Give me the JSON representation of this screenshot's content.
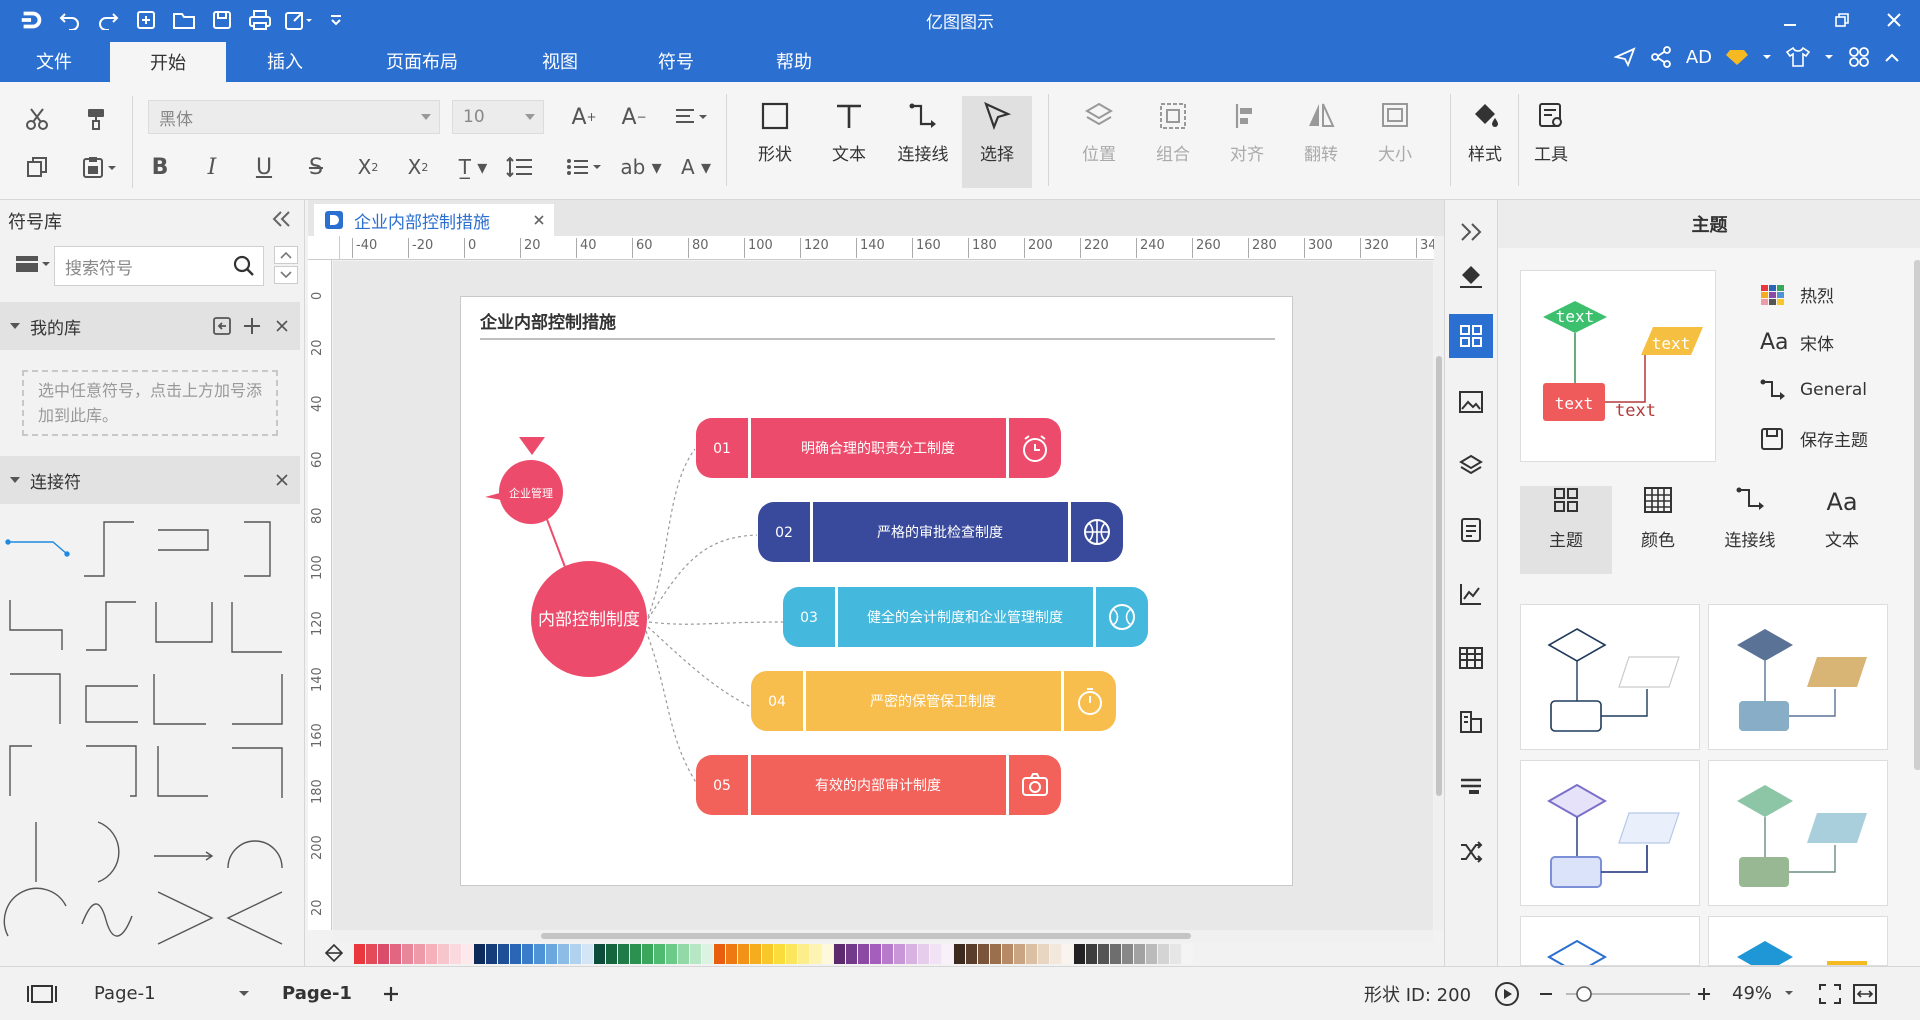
{
  "app": {
    "title": "亿图图示"
  },
  "menus": [
    {
      "label": "文件"
    },
    {
      "label": "开始"
    },
    {
      "label": "插入"
    },
    {
      "label": "页面布局"
    },
    {
      "label": "视图"
    },
    {
      "label": "符号"
    },
    {
      "label": "帮助"
    }
  ],
  "account": {
    "label": "AD"
  },
  "ribbon": {
    "font_name": "黑体",
    "font_size": "10",
    "big_buttons": [
      {
        "label": "形状"
      },
      {
        "label": "文本"
      },
      {
        "label": "连接线"
      },
      {
        "label": "选择"
      },
      {
        "label": "位置"
      },
      {
        "label": "组合"
      },
      {
        "label": "对齐"
      },
      {
        "label": "翻转"
      },
      {
        "label": "大小"
      },
      {
        "label": "样式"
      },
      {
        "label": "工具"
      }
    ]
  },
  "left_panel": {
    "title": "符号库",
    "search_placeholder": "搜索符号",
    "my_library": "我的库",
    "hint": "选中任意符号，点击上方加号添加到此库。",
    "connectors": "连接符"
  },
  "document": {
    "tab_title": "企业内部控制措施"
  },
  "ruler": {
    "h": [
      "-40",
      "-20",
      "0",
      "20",
      "40",
      "60",
      "80",
      "100",
      "120",
      "140",
      "160",
      "180",
      "200",
      "220",
      "240",
      "260",
      "280",
      "300",
      "320",
      "34"
    ],
    "v": [
      "0",
      "20",
      "40",
      "60",
      "80",
      "100",
      "120",
      "140",
      "160",
      "180",
      "200",
      "20"
    ]
  },
  "diagram": {
    "title": "企业内部控制措施",
    "center": "内部控制制度",
    "small": "企业管理",
    "items": [
      {
        "num": "01",
        "text": "明确合理的职责分工制度",
        "color": "#ec4b6b",
        "icon": "alarm-clock-icon"
      },
      {
        "num": "02",
        "text": "严格的审批检查制度",
        "color": "#394a9c",
        "icon": "basketball-icon"
      },
      {
        "num": "03",
        "text": "健全的会计制度和企业管理制度",
        "color": "#44b8dd",
        "icon": "baseball-icon"
      },
      {
        "num": "04",
        "text": "严密的保管保卫制度",
        "color": "#f7bd4d",
        "icon": "stopwatch-icon"
      },
      {
        "num": "05",
        "text": "有效的内部审计制度",
        "color": "#f2625b",
        "icon": "camera-icon"
      }
    ]
  },
  "right_panel": {
    "title": "主题",
    "preview_text": "text",
    "options": [
      {
        "label": "热烈",
        "icon": "color-grid-icon"
      },
      {
        "label": "宋体",
        "icon": "font-aa-icon"
      },
      {
        "label": "General",
        "icon": "connector-icon"
      },
      {
        "label": "保存主题",
        "icon": "save-icon"
      }
    ],
    "tabs": [
      {
        "label": "主题"
      },
      {
        "label": "颜色"
      },
      {
        "label": "连接线"
      },
      {
        "label": "文本"
      }
    ]
  },
  "status": {
    "page_select": "Page-1",
    "page_tab": "Page-1",
    "shape_id": "形状 ID:  200",
    "zoom": "49%"
  },
  "palette": [
    "#e8383d",
    "#e34a5a",
    "#d94d6a",
    "#e26680",
    "#e8869b",
    "#ef9aa8",
    "#f5b0b9",
    "#f7c6cc",
    "#fadadf",
    "#fce9ec",
    "#0c2b5b",
    "#163d7a",
    "#1f4f96",
    "#2a65b6",
    "#3a7cc9",
    "#4d93d6",
    "#6aa8df",
    "#8dbde6",
    "#b0d2ee",
    "#d4e6f6",
    "#0b4d3a",
    "#15653f",
    "#1f7b48",
    "#2c9050",
    "#3aa65c",
    "#4fbb70",
    "#6ccb89",
    "#92d9a7",
    "#b8e7c5",
    "#dcf3e3",
    "#e85d0e",
    "#ee7812",
    "#f29318",
    "#f5ad1f",
    "#f8c72a",
    "#fadc3b",
    "#fbe65e",
    "#fcee8a",
    "#fdf4b4",
    "#fef9dc",
    "#5b2b6e",
    "#73398a",
    "#8c4aa4",
    "#a35fbb",
    "#b87acb",
    "#c997d7",
    "#d8b3e2",
    "#e6cdec",
    "#f1e3f5",
    "#f8f1fa",
    "#3d2a1e",
    "#5a3d2a",
    "#7a553a",
    "#9a6f4e",
    "#b68a66",
    "#caa584",
    "#dbc0a4",
    "#e8d6c2",
    "#f2e8dc",
    "#f9f4ee",
    "#222222",
    "#3d3d3d",
    "#555555",
    "#6e6e6e",
    "#888888",
    "#a2a2a2",
    "#bbbbbb",
    "#d4d4d4",
    "#e6e6e6",
    "#f4f4f4"
  ]
}
